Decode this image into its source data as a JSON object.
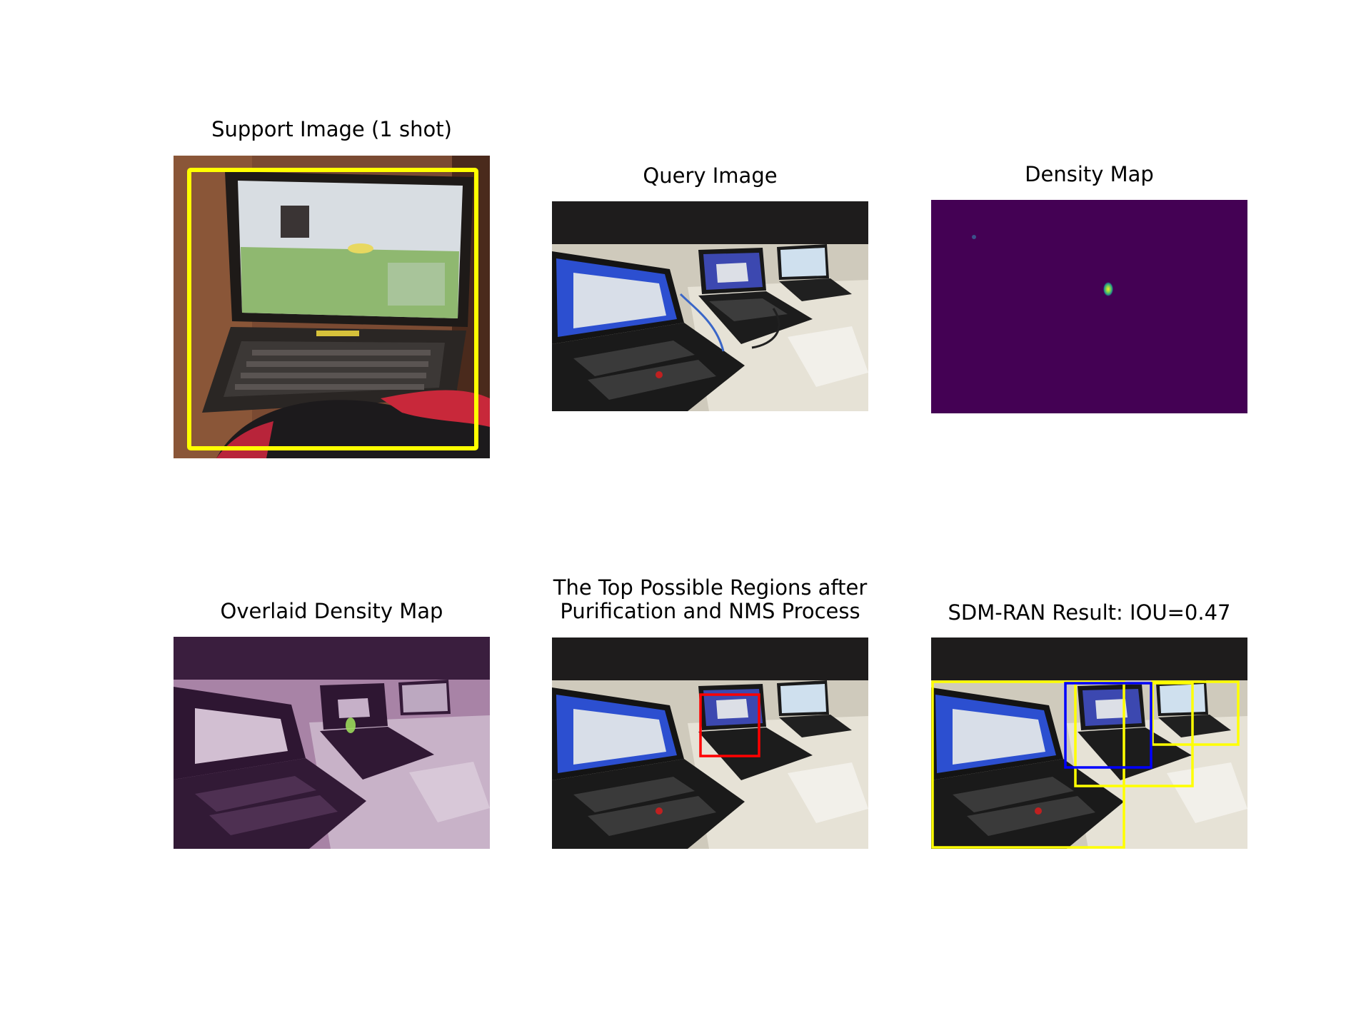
{
  "panels": {
    "support": {
      "title": "Support Image (1 shot)"
    },
    "query": {
      "title": "Query Image"
    },
    "density": {
      "title": "Density Map"
    },
    "overlay": {
      "title": "Overlaid Density Map"
    },
    "regions": {
      "title_line1": "The Top Possible Regions after",
      "title_line2": "Purification and NMS Process"
    },
    "result": {
      "title": "SDM-RAN Result: IOU=0.47"
    }
  },
  "colors": {
    "ground_truth_box": "#ffff00",
    "candidate_box": "#ff0000",
    "prediction_box": "#0000ff",
    "density_background": "#440154",
    "density_peak": "#7ad151"
  }
}
